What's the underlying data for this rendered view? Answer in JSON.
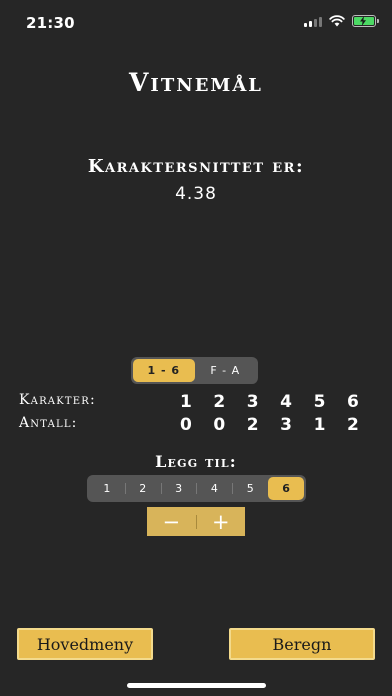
{
  "status": {
    "time": "21:30",
    "icons": [
      "signal-icon",
      "wifi-icon",
      "battery-charging-icon"
    ],
    "battery_color": "#4cd964"
  },
  "header": {
    "title": "Vitnemål"
  },
  "average": {
    "label": "Karaktersnittet er:",
    "value": "4.38"
  },
  "scale_toggle": {
    "options": [
      "1 - 6",
      "F - A"
    ],
    "selected": "1 - 6"
  },
  "grades_table": {
    "karakter_label": "Karakter:",
    "antall_label": "Antall:",
    "karakter_values": [
      "1",
      "2",
      "3",
      "4",
      "5",
      "6"
    ],
    "antall_values": [
      "0",
      "0",
      "2",
      "3",
      "1",
      "2"
    ]
  },
  "add": {
    "label": "Legg til:",
    "options": [
      "1",
      "2",
      "3",
      "4",
      "5",
      "6"
    ],
    "selected": "6",
    "minus_symbol": "−",
    "plus_symbol": "+"
  },
  "buttons": {
    "menu_label": "Hovedmeny",
    "calculate_label": "Beregn"
  },
  "colors": {
    "background": "#262626",
    "accent": "#e9bd50"
  }
}
